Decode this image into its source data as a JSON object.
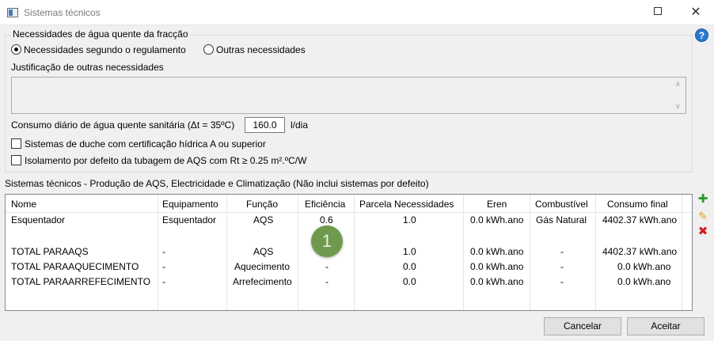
{
  "window": {
    "title": "Sistemas técnicos"
  },
  "group": {
    "title": "Necessidades de água quente da fracção",
    "radio_regulamento": "Necessidades segundo o regulamento",
    "radio_outras": "Outras necessidades",
    "justificacao_label": "Justificação de outras necessidades",
    "consumo_label": "Consumo diário de água quente sanitária (Δt = 35ºC)",
    "consumo_value": "160.0",
    "consumo_unit": "l/dia",
    "check_duche": "Sistemas de duche com certificação hídrica A ou superior",
    "check_isolamento": "Isolamento por defeito da tubagem de AQS com Rt ≥ 0.25 m².ºC/W"
  },
  "section_title": "Sistemas técnicos - Produção de AQS, Electricidade e Climatização (Não inclui sistemas por defeito)",
  "table": {
    "columns": [
      "Nome",
      "Equipamento",
      "Função",
      "Eficiência",
      "Parcela Necessidades",
      "Eren",
      "Combustível",
      "Consumo final"
    ],
    "rows": [
      [
        "Esquentador",
        "Esquentador",
        "AQS",
        "0.6",
        "1.0",
        "0.0 kWh.ano",
        "Gás Natural",
        "4402.37 kWh.ano"
      ],
      [
        "",
        "",
        "",
        "",
        "",
        "",
        "",
        ""
      ],
      [
        "TOTAL PARAAQS",
        "-",
        "AQS",
        "",
        "1.0",
        "0.0 kWh.ano",
        "-",
        "4402.37 kWh.ano"
      ],
      [
        "TOTAL PARAAQUECIMENTO",
        "-",
        "Aquecimento",
        "-",
        "0.0",
        "0.0 kWh.ano",
        "-",
        "0.0 kWh.ano"
      ],
      [
        "TOTAL PARAARREFECIMENTO",
        "-",
        "Arrefecimento",
        "-",
        "0.0",
        "0.0 kWh.ano",
        "-",
        "0.0 kWh.ano"
      ]
    ]
  },
  "marker_label": "1",
  "buttons": {
    "cancel": "Cancelar",
    "ok": "Aceitar"
  },
  "icons": {
    "help": "help-icon",
    "add": "plus-icon",
    "edit": "pencil-icon",
    "delete": "x-icon"
  },
  "colors": {
    "add": "#2a9a2a",
    "edit": "#e8a317",
    "delete": "#d42020",
    "help": "#2c78d0",
    "marker": "#6f9a4e"
  }
}
